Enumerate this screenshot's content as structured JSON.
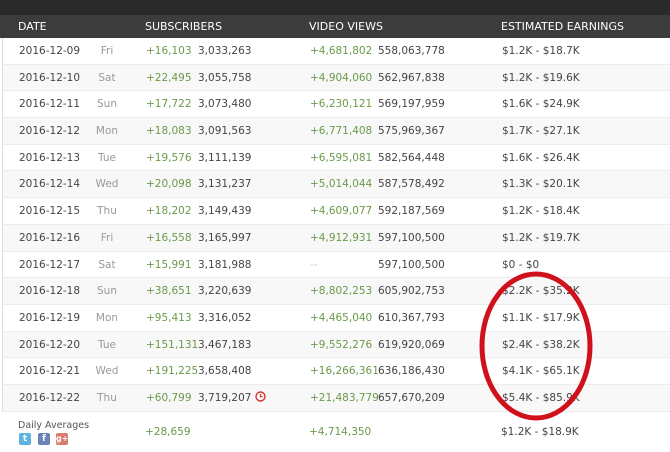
{
  "header": {
    "date": "DATE",
    "subscribers": "SUBSCRIBERS",
    "video_views": "VIDEO VIEWS",
    "earnings": "ESTIMATED EARNINGS"
  },
  "rows": [
    {
      "date": "2016-12-09",
      "day": "Fri",
      "sub_delta": "+16,103",
      "sub_total": "3,033,263",
      "view_delta": "+4,681,802",
      "view_total": "558,063,778",
      "earnings": "$1.2K  -  $18.7K"
    },
    {
      "date": "2016-12-10",
      "day": "Sat",
      "sub_delta": "+22,495",
      "sub_total": "3,055,758",
      "view_delta": "+4,904,060",
      "view_total": "562,967,838",
      "earnings": "$1.2K  -  $19.6K"
    },
    {
      "date": "2016-12-11",
      "day": "Sun",
      "sub_delta": "+17,722",
      "sub_total": "3,073,480",
      "view_delta": "+6,230,121",
      "view_total": "569,197,959",
      "earnings": "$1.6K  -  $24.9K"
    },
    {
      "date": "2016-12-12",
      "day": "Mon",
      "sub_delta": "+18,083",
      "sub_total": "3,091,563",
      "view_delta": "+6,771,408",
      "view_total": "575,969,367",
      "earnings": "$1.7K  -  $27.1K"
    },
    {
      "date": "2016-12-13",
      "day": "Tue",
      "sub_delta": "+19,576",
      "sub_total": "3,111,139",
      "view_delta": "+6,595,081",
      "view_total": "582,564,448",
      "earnings": "$1.6K  -  $26.4K"
    },
    {
      "date": "2016-12-14",
      "day": "Wed",
      "sub_delta": "+20,098",
      "sub_total": "3,131,237",
      "view_delta": "+5,014,044",
      "view_total": "587,578,492",
      "earnings": "$1.3K  -  $20.1K"
    },
    {
      "date": "2016-12-15",
      "day": "Thu",
      "sub_delta": "+18,202",
      "sub_total": "3,149,439",
      "view_delta": "+4,609,077",
      "view_total": "592,187,569",
      "earnings": "$1.2K  -  $18.4K"
    },
    {
      "date": "2016-12-16",
      "day": "Fri",
      "sub_delta": "+16,558",
      "sub_total": "3,165,997",
      "view_delta": "+4,912,931",
      "view_total": "597,100,500",
      "earnings": "$1.2K  -  $19.7K"
    },
    {
      "date": "2016-12-17",
      "day": "Sat",
      "sub_delta": "+15,991",
      "sub_total": "3,181,988",
      "view_delta": "--",
      "view_total": "597,100,500",
      "earnings": "$0  -  $0"
    },
    {
      "date": "2016-12-18",
      "day": "Sun",
      "sub_delta": "+38,651",
      "sub_total": "3,220,639",
      "view_delta": "+8,802,253",
      "view_total": "605,902,753",
      "earnings": "$2.2K  -  $35.2K"
    },
    {
      "date": "2016-12-19",
      "day": "Mon",
      "sub_delta": "+95,413",
      "sub_total": "3,316,052",
      "view_delta": "+4,465,040",
      "view_total": "610,367,793",
      "earnings": "$1.1K  -  $17.9K"
    },
    {
      "date": "2016-12-20",
      "day": "Tue",
      "sub_delta": "+151,131",
      "sub_total": "3,467,183",
      "view_delta": "+9,552,276",
      "view_total": "619,920,069",
      "earnings": "$2.4K  -  $38.2K"
    },
    {
      "date": "2016-12-21",
      "day": "Wed",
      "sub_delta": "+191,225",
      "sub_total": "3,658,408",
      "view_delta": "+16,266,361",
      "view_total": "636,186,430",
      "earnings": "$4.1K  -  $65.1K"
    },
    {
      "date": "2016-12-22",
      "day": "Thu",
      "sub_delta": "+60,799",
      "sub_total": "3,719,207",
      "view_delta": "+21,483,779",
      "view_total": "657,670,209",
      "earnings": "$5.4K  -  $85.9K"
    }
  ],
  "averages": {
    "label": "Daily Averages",
    "sub_delta": "+28,659",
    "view_delta": "+4,714,350",
    "earnings": "$1.2K  -  $18.9K"
  },
  "icons": [
    "clock-icon",
    "twitter-icon",
    "facebook-icon",
    "google-plus-icon"
  ],
  "colors": {
    "green": "#6a9a4a",
    "header": "#3c3c3c",
    "annotation": "#d0101a"
  }
}
